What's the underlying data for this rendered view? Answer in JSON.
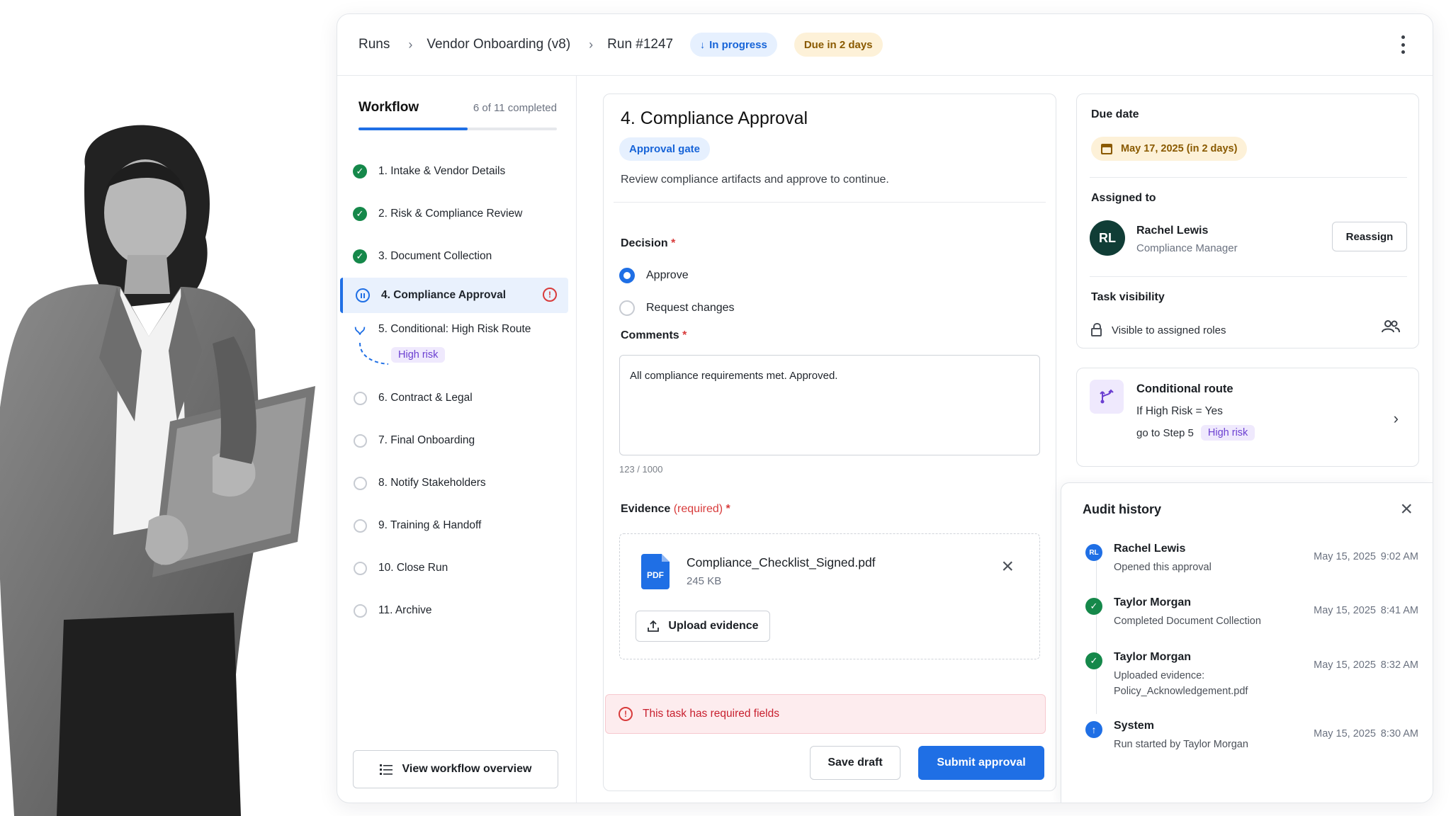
{
  "breadcrumb": {
    "runs": "Runs",
    "template": "Vendor Onboarding (v8)",
    "run": "Run #1247"
  },
  "status": {
    "label": "In progress",
    "color": "#1764d8"
  },
  "due_badge": {
    "label": "Due in 2 days",
    "color": "#8a5a00"
  },
  "workflow": {
    "title": "Workflow",
    "progress_text": "6 of 11 completed",
    "progress_fraction": 0.55,
    "steps": [
      {
        "label": "1. Intake & Vendor Details",
        "state": "done"
      },
      {
        "label": "2. Risk & Compliance Review",
        "state": "done"
      },
      {
        "label": "3. Document Collection",
        "state": "done"
      },
      {
        "label": "4. Compliance Approval",
        "state": "active"
      },
      {
        "label": "5. Conditional: High Risk Route",
        "state": "conditional",
        "badge": "High risk"
      },
      {
        "label": "6. Contract & Legal",
        "state": "todo"
      },
      {
        "label": "7. Final Onboarding",
        "state": "todo"
      },
      {
        "label": "8. Notify Stakeholders",
        "state": "todo"
      },
      {
        "label": "9. Training & Handoff",
        "state": "todo"
      },
      {
        "label": "10. Close Run",
        "state": "todo"
      },
      {
        "label": "11. Archive",
        "state": "todo"
      }
    ],
    "overview_button": "View workflow overview"
  },
  "task": {
    "title": "4. Compliance Approval",
    "gate_badge": "Approval gate",
    "description": "Review compliance artifacts and approve to continue.",
    "decision_label": "Decision",
    "required_mark": "*",
    "options": [
      {
        "label": "Approve",
        "selected": true
      },
      {
        "label": "Request changes",
        "selected": false
      }
    ],
    "comments_label": "Comments",
    "comment_value": "All compliance requirements met. Approved.",
    "char_count": "123 / 1000",
    "evidence_label": "Evidence",
    "evidence_required": "(required)",
    "file": {
      "icon": "PDF",
      "name": "Compliance_Checklist_Signed.pdf",
      "size": "245 KB"
    },
    "upload_button": "Upload evidence",
    "alert": "This task has required fields",
    "save_button": "Save draft",
    "submit_button": "Submit approval"
  },
  "details": {
    "due_date_label": "Due date",
    "due_date_value": "May 17, 2025 (in 2 days)",
    "assigned_label": "Assigned to",
    "assignee": {
      "initials": "RL",
      "name": "Rachel Lewis",
      "role": "Compliance Manager"
    },
    "reassign_button": "Reassign",
    "visibility_label": "Task visibility",
    "visibility_value": "Visible to assigned roles"
  },
  "route": {
    "title": "Conditional route",
    "condition": "If High Risk = Yes",
    "target": "go to Step 5",
    "badge": "High risk"
  },
  "audit": {
    "title": "Audit history",
    "events": [
      {
        "avatar": "RL",
        "kind": "user",
        "name": "Rachel Lewis",
        "desc": "Opened this approval",
        "date": "May 15, 2025",
        "time": "9:02 AM"
      },
      {
        "avatar": "check",
        "kind": "done",
        "name": "Taylor Morgan",
        "desc": "Completed Document Collection",
        "date": "May 15, 2025",
        "time": "8:41 AM"
      },
      {
        "avatar": "check",
        "kind": "done",
        "name": "Taylor Morgan",
        "desc": "Uploaded evidence: Policy_Acknowledgement.pdf",
        "date": "May 15, 2025",
        "time": "8:32 AM"
      },
      {
        "avatar": "arrow-up",
        "kind": "system",
        "name": "System",
        "desc": "Run started by Taylor Morgan",
        "date": "May 15, 2025",
        "time": "8:30 AM"
      }
    ]
  },
  "colors": {
    "accent": "#1f6fe5",
    "success": "#15884a",
    "danger": "#d83b3b",
    "purple": "#6b3fd1"
  }
}
